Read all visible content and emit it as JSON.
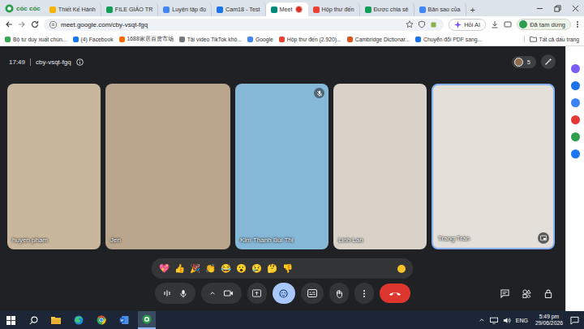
{
  "browser": {
    "logo": "cốc cốc",
    "tabs": [
      {
        "label": "Thiết Kế Hành",
        "selected": false,
        "recording": false,
        "color": "#f4b400"
      },
      {
        "label": "FILE GIÁO TR",
        "selected": false,
        "recording": false,
        "color": "#0f9d58"
      },
      {
        "label": "Luyện tập đọ",
        "selected": false,
        "recording": false,
        "color": "#4285f4"
      },
      {
        "label": "Cam18 - Test",
        "selected": false,
        "recording": false,
        "color": "#1a73e8"
      },
      {
        "label": "Meet",
        "selected": true,
        "recording": true,
        "color": "#00897b"
      },
      {
        "label": "Hộp thư đến",
        "selected": false,
        "recording": false,
        "color": "#ea4335"
      },
      {
        "label": "Được chia sẻ",
        "selected": false,
        "recording": false,
        "color": "#0f9d58"
      },
      {
        "label": "Bản sao của",
        "selected": false,
        "recording": false,
        "color": "#4285f4"
      }
    ],
    "new_tab": "+",
    "address": "meet.google.com/cby-vsqt-fgq",
    "ask_ai": "Hỏi AI",
    "profile": "Đã tạm dừng",
    "bookmarks": [
      {
        "label": "Bộ tư duy xuất chún...",
        "color": "#34a853"
      },
      {
        "label": "(4) Facebook",
        "color": "#1877f2"
      },
      {
        "label": "1688家居百货市场",
        "color": "#ff6a00"
      },
      {
        "label": "Tải video TikTok khô...",
        "color": "#777777"
      },
      {
        "label": "Google",
        "color": "#4285f4"
      },
      {
        "label": "Hộp thư đến (2.920)...",
        "color": "#ea4335"
      },
      {
        "label": "Cambridge Dictionar...",
        "color": "#d9541e"
      },
      {
        "label": "Chuyển đổi PDF sang...",
        "color": "#1a73e8"
      }
    ],
    "all_bookmarks": "Tất cả dấu trang"
  },
  "meet": {
    "time": "17:49",
    "code": "cby-vsqt-fgq",
    "participant_count": "5",
    "tiles": [
      {
        "name": "huyen pham",
        "muted": false,
        "speaking": false,
        "color": "#c8b79c"
      },
      {
        "name": "Jen",
        "muted": false,
        "speaking": false,
        "color": "#b9a68c"
      },
      {
        "name": "Kim Thanh Bùi Thị",
        "muted": true,
        "speaking": false,
        "color": "#86b8d8"
      },
      {
        "name": "Linh Lan",
        "muted": false,
        "speaking": false,
        "color": "#d8d2c8"
      },
      {
        "name": "Trang Trần",
        "muted": false,
        "speaking": true,
        "color": "#e4dfd8"
      }
    ],
    "reactions": [
      "💖",
      "👍",
      "🎉",
      "👏",
      "😂",
      "😮",
      "😢",
      "🤔",
      "👎"
    ],
    "controls": [
      {
        "kind": "mic",
        "active": false
      },
      {
        "kind": "camera",
        "active": false
      },
      {
        "kind": "present",
        "active": false
      },
      {
        "kind": "reactions",
        "active": true
      },
      {
        "kind": "captions",
        "active": false
      },
      {
        "kind": "hand",
        "active": false
      },
      {
        "kind": "more",
        "active": false
      },
      {
        "kind": "leave",
        "active": false
      }
    ],
    "side_controls": [
      {
        "kind": "chat"
      },
      {
        "kind": "activities"
      },
      {
        "kind": "host"
      }
    ]
  },
  "sidebar": [
    {
      "color": "#7b5cf5"
    },
    {
      "color": "#1a73e8"
    },
    {
      "color": "#3b82f6"
    },
    {
      "color": "#e53935"
    },
    {
      "color": "#2e9e4f"
    },
    {
      "color": "#1877f2"
    }
  ],
  "taskbar": {
    "apps": [
      {
        "kind": "start",
        "active": false
      },
      {
        "kind": "search",
        "active": false
      },
      {
        "kind": "explorer",
        "active": false
      },
      {
        "kind": "edge",
        "active": false
      },
      {
        "kind": "chrome",
        "active": false
      },
      {
        "kind": "word",
        "active": false
      },
      {
        "kind": "coccoc",
        "active": true
      }
    ],
    "lang": "ENG",
    "time": "5:49 pm",
    "date": "29/06/2026"
  }
}
